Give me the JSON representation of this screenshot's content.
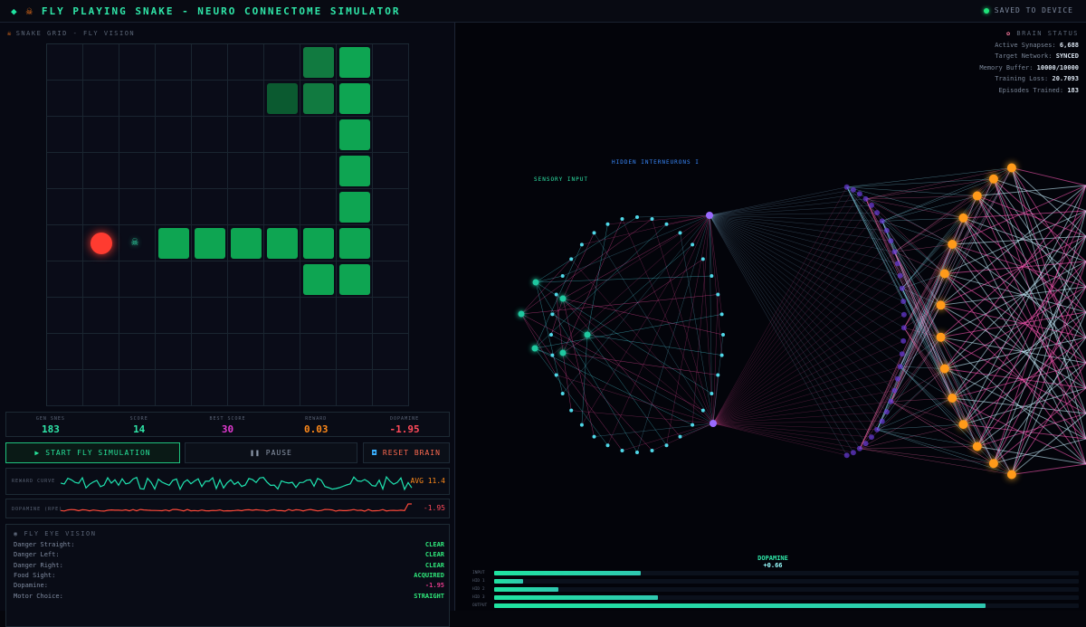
{
  "header": {
    "title": "FLY PLAYING SNAKE - NEURO CONNECTOME SIMULATOR",
    "saved": "SAVED TO DEVICE"
  },
  "grid_section": {
    "label": "SNAKE GRID - FLY VISION"
  },
  "stats": [
    {
      "label": "GEN SNES",
      "value": "183",
      "color": "#2fe6a8"
    },
    {
      "label": "SCORE",
      "value": "14",
      "color": "#2fe6a8"
    },
    {
      "label": "BEST SCORE",
      "value": "30",
      "color": "#e23ad1"
    },
    {
      "label": "REWARD",
      "value": "0.03",
      "color": "#ff8a1a"
    },
    {
      "label": "DOPAMINE",
      "value": "-1.95",
      "color": "#ff4a5a"
    }
  ],
  "controls": {
    "start": "START FLY SIMULATION",
    "pause": "PAUSE",
    "reset": "RESET BRAIN"
  },
  "sparks": {
    "reward": {
      "label": "REWARD CURVE",
      "value": "AVG 11.4"
    },
    "dopamine": {
      "label": "DOPAMINE (RPE)",
      "value": "-1.95"
    }
  },
  "vision": {
    "title": "FLY EYE VISION",
    "rows": [
      {
        "label": "Danger Straight:",
        "value": "CLEAR",
        "color": "#2fe67a"
      },
      {
        "label": "Danger Left:",
        "value": "CLEAR",
        "color": "#2fe67a"
      },
      {
        "label": "Danger Right:",
        "value": "CLEAR",
        "color": "#2fe67a"
      },
      {
        "label": "Food Sight:",
        "value": "ACQUIRED",
        "color": "#2fe67a"
      },
      {
        "label": "Dopamine:",
        "value": "-1.95",
        "color": "#e23a8a"
      },
      {
        "label": "Motor Choice:",
        "value": "STRAIGHT",
        "color": "#2fe67a"
      }
    ]
  },
  "brain_status": {
    "title": "BRAIN STATUS",
    "rows": [
      {
        "label": "Active Synapses:",
        "value": "6,688"
      },
      {
        "label": "Target Network:",
        "value": "SYNCED"
      },
      {
        "label": "Memory Buffer:",
        "value": "10000/10000"
      },
      {
        "label": "Training Loss:",
        "value": "20.7093"
      },
      {
        "label": "Episodes Trained:",
        "value": "183"
      }
    ]
  },
  "network": {
    "sensory_label": "SENSORY INPUT",
    "hidden_label": "HIDDEN INTERNEURONS I"
  },
  "dopamine_meter": {
    "label": "DOPAMINE",
    "value": "+0.66"
  },
  "activity_bars": [
    {
      "label": "INPUT",
      "level": 0.25
    },
    {
      "label": "HID 1",
      "level": 0.05
    },
    {
      "label": "HID 2",
      "level": 0.11
    },
    {
      "label": "HID 3",
      "level": 0.28
    },
    {
      "label": "OUTPUT",
      "level": 0.84
    }
  ],
  "snake": {
    "cols": 10,
    "rows": 10,
    "food": [
      1,
      5
    ],
    "fly": [
      2,
      5
    ],
    "body": [
      [
        3,
        5
      ],
      [
        4,
        5
      ],
      [
        5,
        5
      ],
      [
        6,
        5
      ],
      [
        7,
        5
      ],
      [
        8,
        5
      ],
      [
        8,
        4
      ],
      [
        8,
        3
      ],
      [
        8,
        2
      ],
      [
        8,
        1
      ],
      [
        8,
        0
      ],
      [
        7,
        0
      ],
      [
        7,
        1
      ],
      [
        6,
        1
      ],
      [
        7,
        6
      ],
      [
        8,
        6
      ]
    ],
    "dim": [
      [
        7,
        0
      ],
      [
        7,
        1
      ]
    ],
    "dimmer": [
      [
        6,
        1
      ]
    ]
  }
}
